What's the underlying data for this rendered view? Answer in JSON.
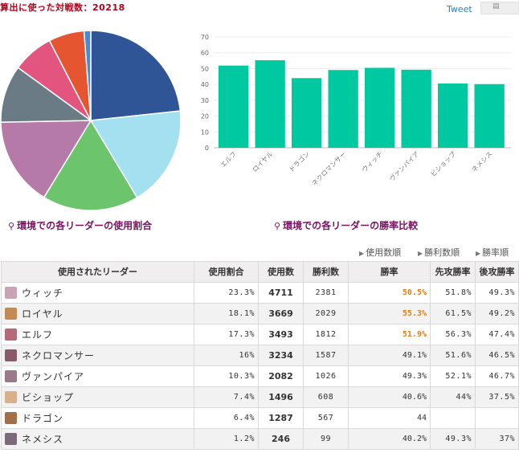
{
  "header": {
    "title": "算出に使った対戦数：20218",
    "tweet_label": "Tweet"
  },
  "captions": {
    "pie": "環境での各リーダーの使用割合",
    "bar": "環境での各リーダーの勝率比較"
  },
  "sort_links": [
    "使用数順",
    "勝利数順",
    "勝率順"
  ],
  "table": {
    "headers": [
      "使用されたリーダー",
      "使用割合",
      "使用数",
      "勝利数",
      "勝率",
      "先攻勝率",
      "後攻勝率"
    ],
    "rows": [
      {
        "name": "ウィッチ",
        "share": "23.3%",
        "uses": "4711",
        "wins": "2381",
        "rate": "50.5%",
        "first": "51.8%",
        "second": "49.3%",
        "hot": true,
        "color": "#c9a2b3"
      },
      {
        "name": "ロイヤル",
        "share": "18.1%",
        "uses": "3669",
        "wins": "2029",
        "rate": "55.3%",
        "first": "61.5%",
        "second": "49.2%",
        "hot": true,
        "color": "#c48a55"
      },
      {
        "name": "エルフ",
        "share": "17.3%",
        "uses": "3493",
        "wins": "1812",
        "rate": "51.9%",
        "first": "56.3%",
        "second": "47.4%",
        "hot": true,
        "color": "#b56a7a"
      },
      {
        "name": "ネクロマンサー",
        "share": "16%",
        "uses": "3234",
        "wins": "1587",
        "rate": "49.1%",
        "first": "51.6%",
        "second": "46.5%",
        "hot": false,
        "color": "#8a5a6a"
      },
      {
        "name": "ヴァンパイア",
        "share": "10.3%",
        "uses": "2082",
        "wins": "1026",
        "rate": "49.3%",
        "first": "52.1%",
        "second": "46.7%",
        "hot": false,
        "color": "#9a7a8a"
      },
      {
        "name": "ビショップ",
        "share": "7.4%",
        "uses": "1496",
        "wins": "608",
        "rate": "40.6%",
        "first": "44%",
        "second": "37.5%",
        "hot": false,
        "color": "#d8b08a"
      },
      {
        "name": "ドラゴン",
        "share": "6.4%",
        "uses": "1287",
        "wins": "567",
        "rate": "44",
        "first": "",
        "second": "",
        "hot": false,
        "color": "#a0704a"
      },
      {
        "name": "ネメシス",
        "share": "1.2%",
        "uses": "246",
        "wins": "99",
        "rate": "40.2%",
        "first": "49.3%",
        "second": "37%",
        "hot": false,
        "color": "#7a6a7a"
      }
    ]
  },
  "chart_data": [
    {
      "type": "pie",
      "categories": [
        "ウィッチ",
        "ロイヤル",
        "エルフ",
        "ネクロマンサー",
        "ヴァンパイア",
        "ビショップ",
        "ドラゴン",
        "ネメシス"
      ],
      "values": [
        23.3,
        18.1,
        17.3,
        16,
        10.3,
        7.4,
        6.4,
        1.2
      ],
      "colors": [
        "#2f5597",
        "#a3e0f0",
        "#6cc46c",
        "#b57aa8",
        "#6b7b86",
        "#e2557e",
        "#e55530",
        "#4a8ad0"
      ]
    },
    {
      "type": "bar",
      "categories": [
        "エルフ",
        "ロイヤル",
        "ドラゴン",
        "ネクロマンサー",
        "ウィッチ",
        "ヴァンパイア",
        "ビショップ",
        "ネメシス"
      ],
      "values": [
        51.9,
        55.3,
        44,
        49.1,
        50.5,
        49.3,
        40.6,
        40.2
      ],
      "ylim": [
        0,
        70
      ],
      "yticks": [
        0,
        10,
        20,
        30,
        40,
        50,
        60,
        70
      ],
      "grid": true,
      "color": "#00c8a0"
    }
  ]
}
